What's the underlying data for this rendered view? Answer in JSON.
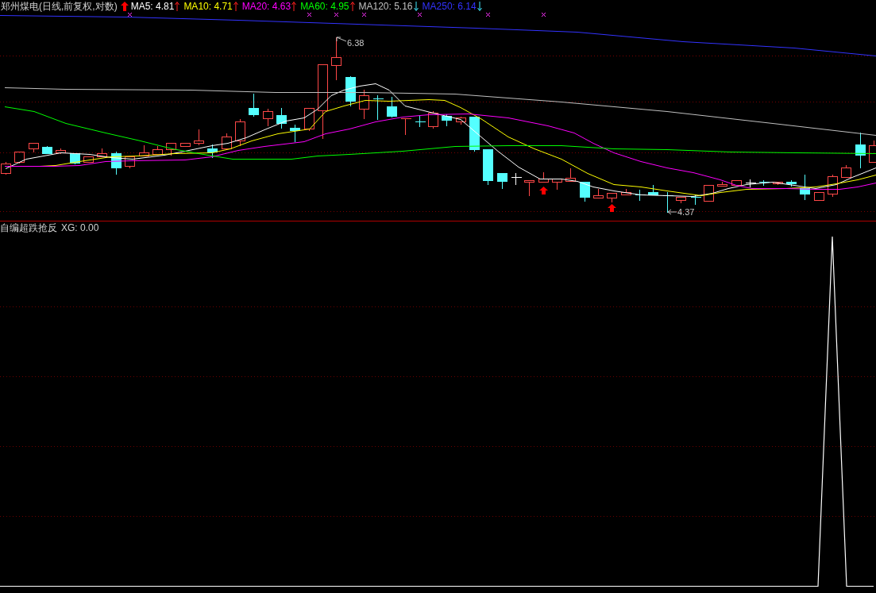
{
  "chart": {
    "title": "郑州煤电(日线,前复权,对数)",
    "moving_averages": [
      {
        "label": "MA5: 4.81",
        "color": "#ffffff",
        "rising": true
      },
      {
        "label": "MA10: 4.71",
        "color": "#ffff00",
        "rising": true
      },
      {
        "label": "MA20: 4.63",
        "color": "#ff00ff",
        "rising": true
      },
      {
        "label": "MA60: 4.95",
        "color": "#00ff00",
        "rising": true
      },
      {
        "label": "MA120: 5.16",
        "color": "#c0c0c0",
        "rising": false
      },
      {
        "label": "MA250: 6.14",
        "color": "#3333ff",
        "rising": false
      }
    ],
    "price_labels": [
      "6.38",
      "4.37"
    ]
  },
  "indicator": {
    "name": "自编超跌抢反",
    "reading": "XG: 0.00"
  }
}
